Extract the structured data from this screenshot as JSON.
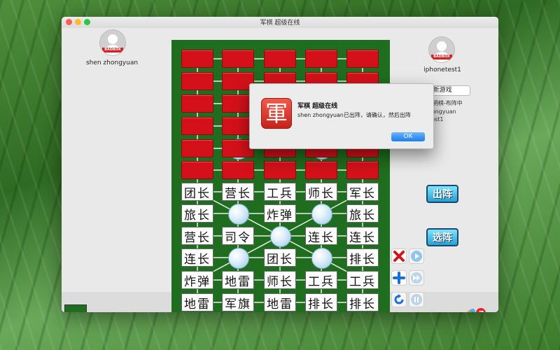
{
  "window": {
    "title": "军棋 超级在线"
  },
  "players": {
    "left": {
      "name": "shen zhongyuan",
      "avatar_tag": "BADBOX"
    },
    "right": {
      "name": "iphonetest1",
      "avatar_tag": "BADBOX"
    }
  },
  "controls": {
    "new_game": "新游戏",
    "deploy": "出阵",
    "choose_formation": "选阵"
  },
  "info_lines": [
    "超级在线模式-明棋-布阵中",
    "红方:shen zhongyuan",
    "黑方:iphonetest1",
    "开局:no",
    "步数:0"
  ],
  "dialog": {
    "icon_char": "軍",
    "title": "军棋 超级在线",
    "message": "shen zhongyuan已出阵，请确认，然后出阵",
    "ok": "OK"
  },
  "board": {
    "opponent_rows": 6,
    "my_rows": [
      [
        "团长",
        "营长",
        "工兵",
        "师长",
        "军长"
      ],
      [
        "旅长",
        "",
        "炸弹",
        "",
        "旅长"
      ],
      [
        "营长",
        "司令",
        "",
        "连长",
        "连长"
      ],
      [
        "连长",
        "",
        "团长",
        "",
        "排长"
      ],
      [
        "炸弹",
        "地雷",
        "师长",
        "工兵",
        "工兵"
      ],
      [
        "地雷",
        "军旗",
        "地雷",
        "排长",
        "排长"
      ]
    ]
  },
  "colors": {
    "board": "#1f6d1f",
    "back_piece": "#d4111a",
    "accent": "#1d7ef0"
  }
}
